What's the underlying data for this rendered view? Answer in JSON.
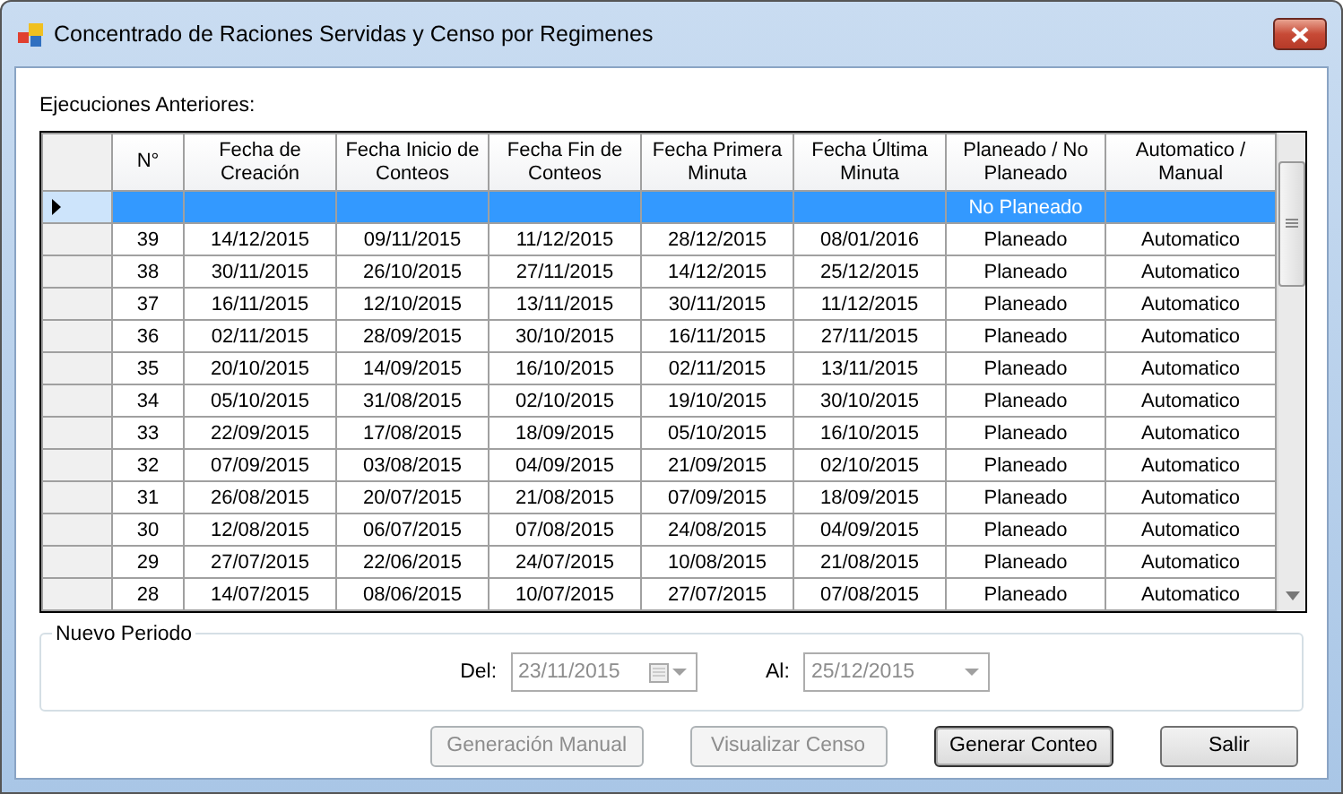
{
  "window": {
    "title": "Concentrado de Raciones Servidas y Censo por Regimenes"
  },
  "grid": {
    "label": "Ejecuciones Anteriores:",
    "columns": [
      "N°",
      "Fecha de Creación",
      "Fecha Inicio de Conteos",
      "Fecha Fin de Conteos",
      "Fecha Primera Minuta",
      "Fecha Última Minuta",
      "Planeado / No Planeado",
      "Automatico / Manual"
    ],
    "rows": [
      {
        "selected": true,
        "cells": [
          "",
          "",
          "",
          "",
          "",
          "",
          "No Planeado",
          ""
        ]
      },
      {
        "selected": false,
        "cells": [
          "39",
          "14/12/2015",
          "09/11/2015",
          "11/12/2015",
          "28/12/2015",
          "08/01/2016",
          "Planeado",
          "Automatico"
        ]
      },
      {
        "selected": false,
        "cells": [
          "38",
          "30/11/2015",
          "26/10/2015",
          "27/11/2015",
          "14/12/2015",
          "25/12/2015",
          "Planeado",
          "Automatico"
        ]
      },
      {
        "selected": false,
        "cells": [
          "37",
          "16/11/2015",
          "12/10/2015",
          "13/11/2015",
          "30/11/2015",
          "11/12/2015",
          "Planeado",
          "Automatico"
        ]
      },
      {
        "selected": false,
        "cells": [
          "36",
          "02/11/2015",
          "28/09/2015",
          "30/10/2015",
          "16/11/2015",
          "27/11/2015",
          "Planeado",
          "Automatico"
        ]
      },
      {
        "selected": false,
        "cells": [
          "35",
          "20/10/2015",
          "14/09/2015",
          "16/10/2015",
          "02/11/2015",
          "13/11/2015",
          "Planeado",
          "Automatico"
        ]
      },
      {
        "selected": false,
        "cells": [
          "34",
          "05/10/2015",
          "31/08/2015",
          "02/10/2015",
          "19/10/2015",
          "30/10/2015",
          "Planeado",
          "Automatico"
        ]
      },
      {
        "selected": false,
        "cells": [
          "33",
          "22/09/2015",
          "17/08/2015",
          "18/09/2015",
          "05/10/2015",
          "16/10/2015",
          "Planeado",
          "Automatico"
        ]
      },
      {
        "selected": false,
        "cells": [
          "32",
          "07/09/2015",
          "03/08/2015",
          "04/09/2015",
          "21/09/2015",
          "02/10/2015",
          "Planeado",
          "Automatico"
        ]
      },
      {
        "selected": false,
        "cells": [
          "31",
          "26/08/2015",
          "20/07/2015",
          "21/08/2015",
          "07/09/2015",
          "18/09/2015",
          "Planeado",
          "Automatico"
        ]
      },
      {
        "selected": false,
        "cells": [
          "30",
          "12/08/2015",
          "06/07/2015",
          "07/08/2015",
          "24/08/2015",
          "04/09/2015",
          "Planeado",
          "Automatico"
        ]
      },
      {
        "selected": false,
        "cells": [
          "29",
          "27/07/2015",
          "22/06/2015",
          "24/07/2015",
          "10/08/2015",
          "21/08/2015",
          "Planeado",
          "Automatico"
        ]
      },
      {
        "selected": false,
        "cells": [
          "28",
          "14/07/2015",
          "08/06/2015",
          "10/07/2015",
          "27/07/2015",
          "07/08/2015",
          "Planeado",
          "Automatico"
        ]
      }
    ]
  },
  "period": {
    "title": "Nuevo Periodo",
    "fields": [
      {
        "kind": "calendar",
        "label": "Del:",
        "value": "23/11/2015",
        "disabled": true
      },
      {
        "kind": "dropdown",
        "label": "Al:",
        "value": "25/12/2015",
        "disabled": true
      }
    ]
  },
  "buttons": [
    {
      "label": "Generación Manual",
      "disabled": true,
      "focused": false
    },
    {
      "label": "Visualizar Censo",
      "disabled": true,
      "focused": false
    },
    {
      "label": "Generar Conteo",
      "disabled": false,
      "focused": true
    },
    {
      "label": "Salir",
      "disabled": false,
      "focused": false
    }
  ]
}
